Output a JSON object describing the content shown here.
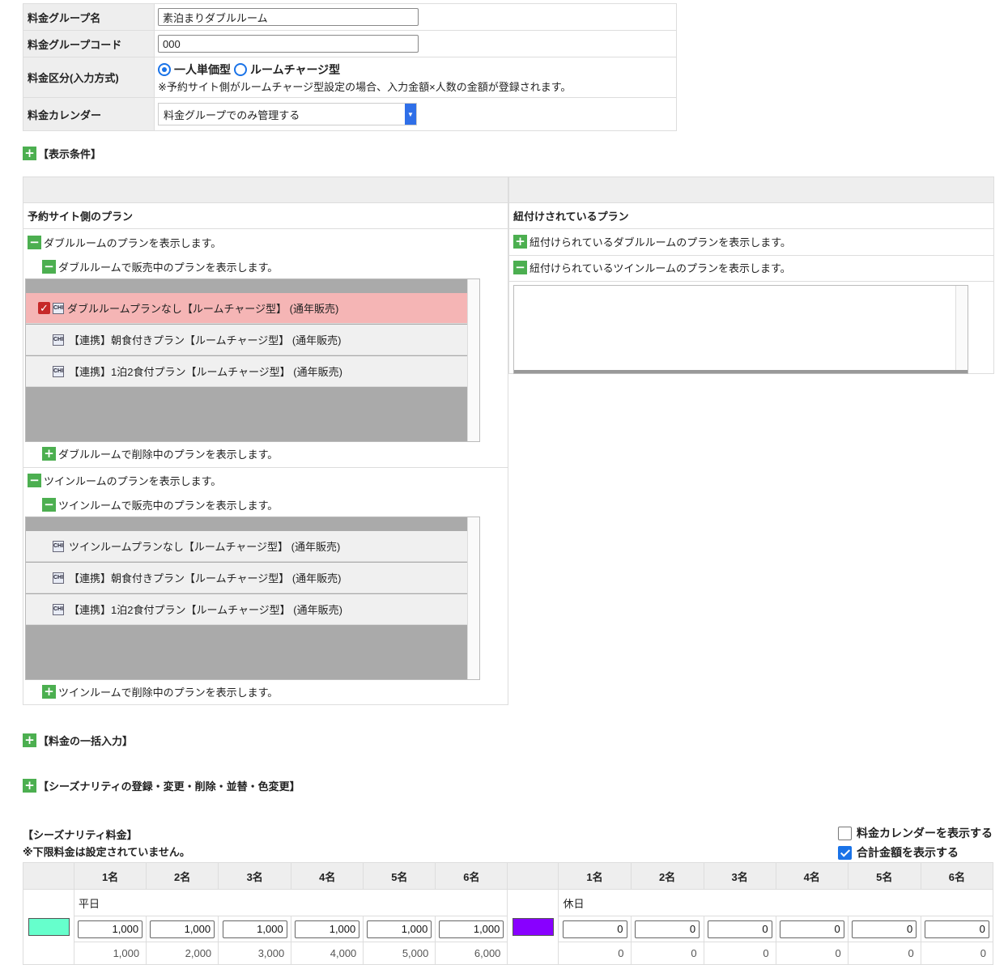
{
  "form": {
    "group_name_label": "料金グループ名",
    "group_name_value": "素泊まりダブルルーム",
    "group_code_label": "料金グループコード",
    "group_code_value": "000",
    "category_label": "料金区分(入力方式)",
    "radio_per_person": "一人単価型",
    "radio_room_charge": "ルームチャージ型",
    "category_note": "※予約サイト側がルームチャージ型設定の場合、入力金額×人数の金額が登録されます。",
    "calendar_label": "料金カレンダー",
    "calendar_value": "料金グループでのみ管理する"
  },
  "display_conditions": "【表示条件】",
  "plans": {
    "left_header": "予約サイト側のプラン",
    "right_header": "紐付けされているプラン",
    "double_toggle": "ダブルルームのプランを表示します。",
    "double_selling": "ダブルルームで販売中のプランを表示します。",
    "double_items": [
      "ダブルルームプランなし【ルームチャージ型】 (通年販売)",
      "【連携】朝食付きプラン【ルームチャージ型】 (通年販売)",
      "【連携】1泊2食付プラン【ルームチャージ型】 (通年販売)"
    ],
    "double_deleted": "ダブルルームで削除中のプランを表示します。",
    "twin_toggle": "ツインルームのプランを表示します。",
    "twin_selling": "ツインルームで販売中のプランを表示します。",
    "twin_items": [
      "ツインルームプランなし【ルームチャージ型】 (通年販売)",
      "【連携】朝食付きプラン【ルームチャージ型】 (通年販売)",
      "【連携】1泊2食付プラン【ルームチャージ型】 (通年販売)"
    ],
    "twin_deleted": "ツインルームで削除中のプランを表示します。",
    "linked_double": "紐付けられているダブルルームのプランを表示します。",
    "linked_twin": "紐付けられているツインルームのプランを表示します。",
    "chi_icon": "CHI"
  },
  "bulk_input": "【料金の一括入力】",
  "seasonality_edit": "【シーズナリティの登録・変更・削除・並替・色変更】",
  "seasonality": {
    "title": "【シーズナリティ料金】",
    "note": "※下限料金は設定されていません。",
    "show_calendar": "料金カレンダーを表示する",
    "show_total": "合計金額を表示する",
    "headers": [
      "1名",
      "2名",
      "3名",
      "4名",
      "5名",
      "6名"
    ],
    "weekday_label": "平日",
    "holiday_label": "休日",
    "weekday_color": "#66ffcc",
    "holiday_color": "#8800ff",
    "weekday_values": [
      "1,000",
      "1,000",
      "1,000",
      "1,000",
      "1,000",
      "1,000"
    ],
    "weekday_totals": [
      "1,000",
      "2,000",
      "3,000",
      "4,000",
      "5,000",
      "6,000"
    ],
    "holiday_values": [
      "0",
      "0",
      "0",
      "0",
      "0",
      "0"
    ],
    "holiday_totals": [
      "0",
      "0",
      "0",
      "0",
      "0",
      "0"
    ]
  }
}
